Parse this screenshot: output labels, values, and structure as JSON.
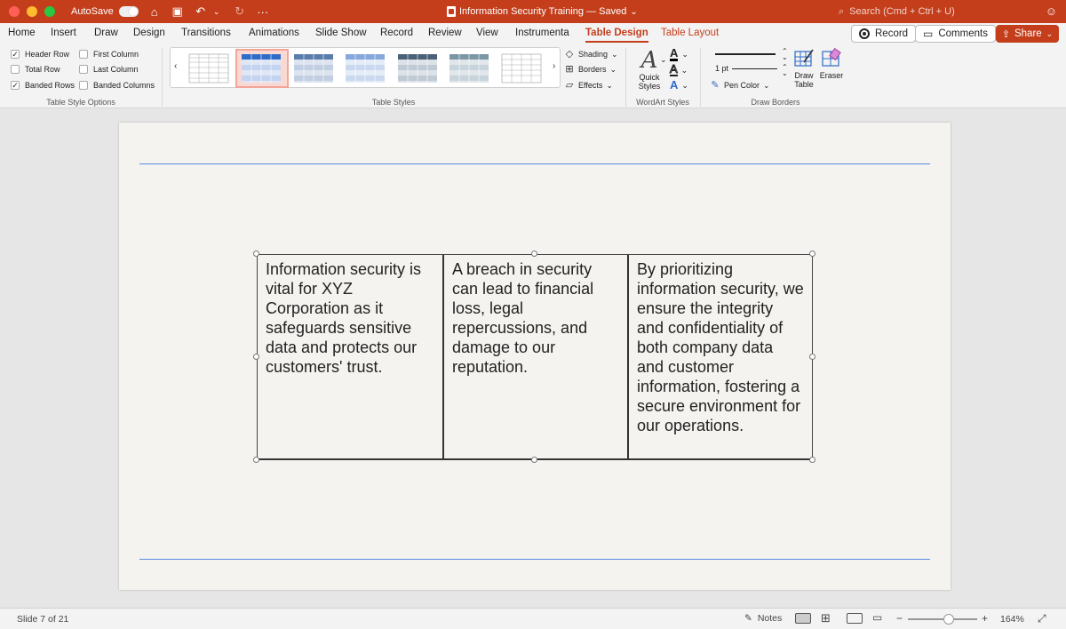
{
  "window": {
    "autosave_label": "AutoSave",
    "doc_title": "Information Security Training — Saved",
    "title_chevron": "⌄",
    "search_placeholder": "Search (Cmd + Ctrl + U)",
    "more_icon": "···"
  },
  "menu": {
    "tabs": [
      {
        "label": "Home"
      },
      {
        "label": "Insert"
      },
      {
        "label": "Draw"
      },
      {
        "label": "Design"
      },
      {
        "label": "Transitions"
      },
      {
        "label": "Animations"
      },
      {
        "label": "Slide Show"
      },
      {
        "label": "Record"
      },
      {
        "label": "Review"
      },
      {
        "label": "View"
      },
      {
        "label": "Instrumenta"
      },
      {
        "label": "Table Design"
      },
      {
        "label": "Table Layout"
      }
    ],
    "active_tab": "Table Design",
    "record_btn": "Record",
    "comments_btn": "Comments",
    "share_btn": "Share"
  },
  "ribbon": {
    "table_style_options": {
      "label": "Table Style Options",
      "header_row": {
        "label": "Header Row",
        "checked": true
      },
      "total_row": {
        "label": "Total Row",
        "checked": false
      },
      "banded_rows": {
        "label": "Banded Rows",
        "checked": true
      },
      "first_column": {
        "label": "First Column",
        "checked": false
      },
      "last_column": {
        "label": "Last Column",
        "checked": false
      },
      "banded_columns": {
        "label": "Banded Columns",
        "checked": false
      }
    },
    "table_styles": {
      "label": "Table Styles",
      "shading": "Shading",
      "borders": "Borders",
      "effects": "Effects"
    },
    "wordart_styles": {
      "label": "WordArt Styles",
      "quick_styles_line1": "Quick",
      "quick_styles_line2": "Styles"
    },
    "draw_borders": {
      "label": "Draw Borders",
      "pen_weight": "1 pt",
      "pen_color": "Pen Color",
      "draw_table_line1": "Draw",
      "draw_table_line2": "Table",
      "eraser": "Eraser"
    }
  },
  "slide": {
    "table": {
      "cells": [
        "Information security is vital for XYZ Corporation as it safeguards sensitive data and protects our customers' trust.",
        "A breach in security can lead to financial loss, legal repercussions, and damage to our reputation.",
        "By prioritizing information security, we ensure the integrity and confidentiality of both company data and customer information, fostering a secure environment for our operations."
      ]
    }
  },
  "status": {
    "slide_count": "Slide 7 of 21",
    "notes": "Notes",
    "zoom": "164%",
    "zoom_level_percent": 164
  },
  "colors": {
    "accent": "#c43e1c",
    "guide_line": "#5b8ce0",
    "slide_bg": "#f4f3ef"
  }
}
